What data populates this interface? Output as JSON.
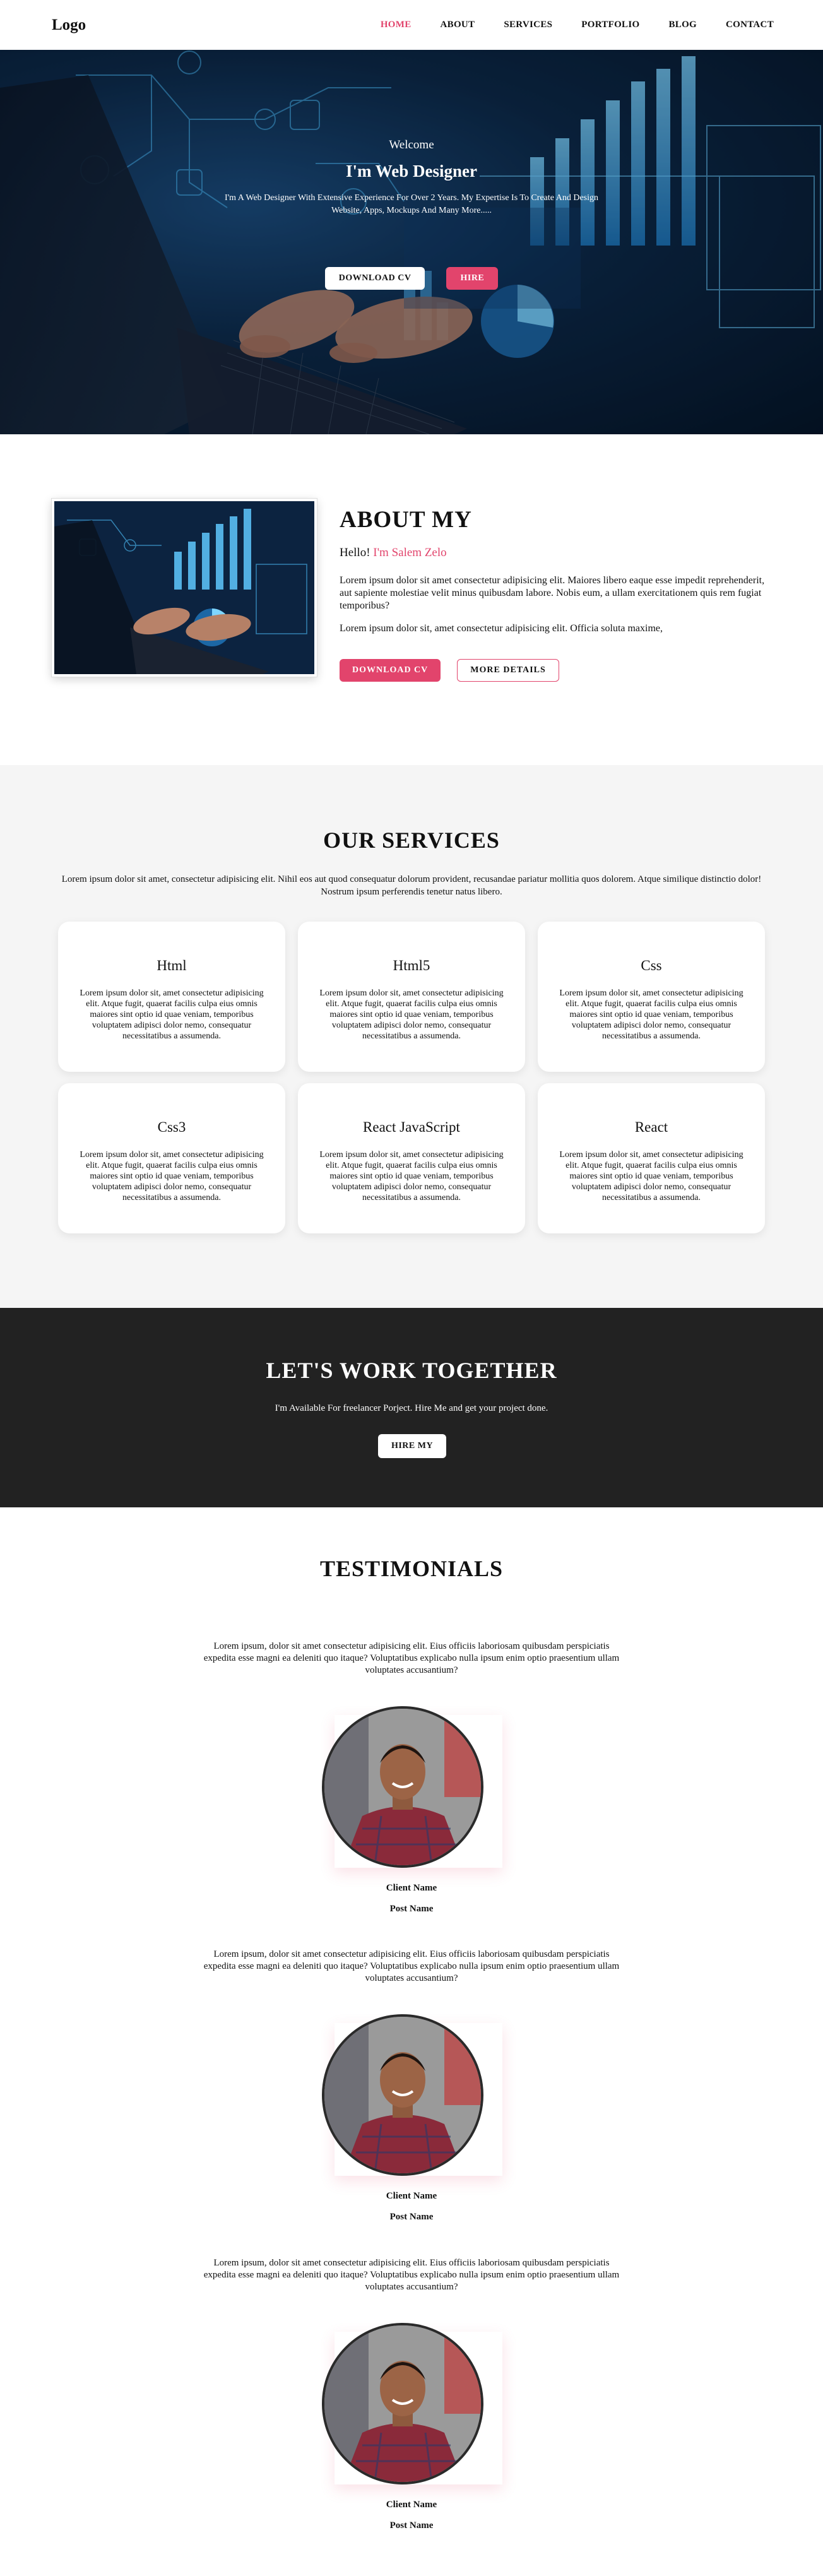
{
  "nav": {
    "logo": "Logo",
    "links": [
      "HOME",
      "ABOUT",
      "SERVICES",
      "PORTFOLIO",
      "BLOG",
      "CONTACT"
    ],
    "active": "HOME"
  },
  "hero": {
    "welcome": "Welcome",
    "title": "I'm Web Designer",
    "description": "I'm A Web Designer With Extensive Experience For Over 2 Years. My Expertise Is To Create And Design Website, Apps, Mockups And Many More.....",
    "download_label": "DOWNLOAD CV",
    "hire_label": "HIRE"
  },
  "about": {
    "title": "ABOUT MY",
    "hello": "Hello!",
    "name": "I'm Salem Zelo",
    "paragraph1": "Lorem ipsum dolor sit amet consectetur adipisicing elit. Maiores libero eaque esse impedit reprehenderit, aut sapiente molestiae velit minus quibusdam labore. Nobis eum, a ullam exercitationem quis rem fugiat temporibus?",
    "paragraph2": "Lorem ipsum dolor sit, amet consectetur adipisicing elit. Officia soluta maxime,",
    "download_label": "DOWNLOAD CV",
    "details_label": "MORE DETAILS"
  },
  "services": {
    "title": "OUR SERVICES",
    "description": "Lorem ipsum dolor sit amet, consectetur adipisicing elit. Nihil eos aut quod consequatur dolorum provident, recusandae pariatur mollitia quos dolorem. Atque similique distinctio dolor! Nostrum ipsum perferendis tenetur natus libero.",
    "cards": [
      {
        "title": "Html",
        "text": "Lorem ipsum dolor sit, amet consectetur adipisicing elit. Atque fugit, quaerat facilis culpa eius omnis maiores sint optio id quae veniam, temporibus voluptatem adipisci dolor nemo, consequatur necessitatibus a assumenda."
      },
      {
        "title": "Html5",
        "text": "Lorem ipsum dolor sit, amet consectetur adipisicing elit. Atque fugit, quaerat facilis culpa eius omnis maiores sint optio id quae veniam, temporibus voluptatem adipisci dolor nemo, consequatur necessitatibus a assumenda."
      },
      {
        "title": "Css",
        "text": "Lorem ipsum dolor sit, amet consectetur adipisicing elit. Atque fugit, quaerat facilis culpa eius omnis maiores sint optio id quae veniam, temporibus voluptatem adipisci dolor nemo, consequatur necessitatibus a assumenda."
      },
      {
        "title": "Css3",
        "text": "Lorem ipsum dolor sit, amet consectetur adipisicing elit. Atque fugit, quaerat facilis culpa eius omnis maiores sint optio id quae veniam, temporibus voluptatem adipisci dolor nemo, consequatur necessitatibus a assumenda."
      },
      {
        "title": "React JavaScript",
        "text": "Lorem ipsum dolor sit, amet consectetur adipisicing elit. Atque fugit, quaerat facilis culpa eius omnis maiores sint optio id quae veniam, temporibus voluptatem adipisci dolor nemo, consequatur necessitatibus a assumenda."
      },
      {
        "title": "React",
        "text": "Lorem ipsum dolor sit, amet consectetur adipisicing elit. Atque fugit, quaerat facilis culpa eius omnis maiores sint optio id quae veniam, temporibus voluptatem adipisci dolor nemo, consequatur necessitatibus a assumenda."
      }
    ]
  },
  "cta": {
    "title": "LET'S WORK TOGETHER",
    "description": "I'm Available For freelancer Porject. Hire Me and get your project done.",
    "button_label": "HIRE MY"
  },
  "testimonials": {
    "title": "TESTIMONIALS",
    "items": [
      {
        "quote": "Lorem ipsum, dolor sit amet consectetur adipisicing elit. Eius officiis laboriosam quibusdam perspiciatis expedita esse magni ea deleniti quo itaque? Voluptatibus explicabo nulla ipsum enim optio praesentium ullam voluptates accusantium?",
        "name": "Client Name",
        "post": "Post Name"
      },
      {
        "quote": "Lorem ipsum, dolor sit amet consectetur adipisicing elit. Eius officiis laboriosam quibusdam perspiciatis expedita esse magni ea deleniti quo itaque? Voluptatibus explicabo nulla ipsum enim optio praesentium ullam voluptates accusantium?",
        "name": "Client Name",
        "post": "Post Name"
      },
      {
        "quote": "Lorem ipsum, dolor sit amet consectetur adipisicing elit. Eius officiis laboriosam quibusdam perspiciatis expedita esse magni ea deleniti quo itaque? Voluptatibus explicabo nulla ipsum enim optio praesentium ullam voluptates accusantium?",
        "name": "Client Name",
        "post": "Post Name"
      }
    ]
  },
  "colors": {
    "accent": "#e2446c",
    "dark_section": "#222222",
    "services_bg": "#f5f5f5"
  }
}
